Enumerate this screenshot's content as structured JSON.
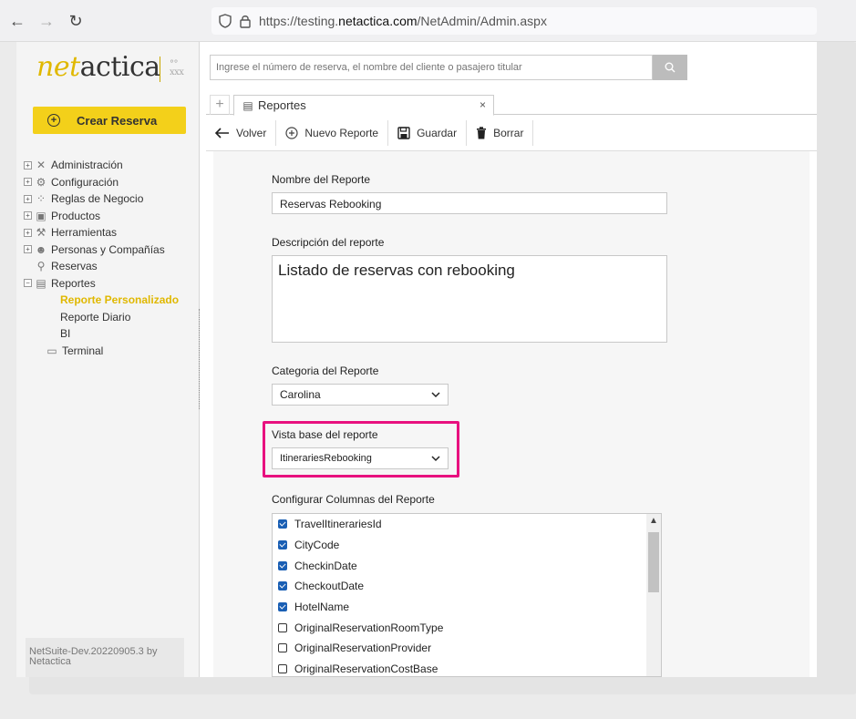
{
  "browser": {
    "url_prefix": "https://testing.",
    "url_domain": "netactica.com",
    "url_path": "/NetAdmin/Admin.aspx"
  },
  "logo": {
    "part1": "net",
    "part2": "actica"
  },
  "sidebar": {
    "crear_label": "Crear Reserva",
    "items": [
      {
        "label": "Administración"
      },
      {
        "label": "Configuración"
      },
      {
        "label": "Reglas de Negocio"
      },
      {
        "label": "Productos"
      },
      {
        "label": "Herramientas"
      },
      {
        "label": "Personas y Compañías"
      },
      {
        "label": "Reservas"
      },
      {
        "label": "Reportes"
      },
      {
        "label": "Reporte Personalizado"
      },
      {
        "label": "Reporte Diario"
      },
      {
        "label": "BI"
      },
      {
        "label": "Terminal"
      }
    ],
    "version": "NetSuite-Dev.20220905.3 by Netactica"
  },
  "search": {
    "placeholder": "Ingrese el número de reserva, el nombre del cliente o pasajero titular"
  },
  "tabs": {
    "active": "Reportes",
    "close": "×",
    "add": "+"
  },
  "toolbar": {
    "volver": "Volver",
    "nuevo": "Nuevo Reporte",
    "guardar": "Guardar",
    "borrar": "Borrar"
  },
  "form": {
    "nombre_label": "Nombre del Reporte",
    "nombre_value": "Reservas Rebooking",
    "descripcion_label": "Descripción del reporte",
    "descripcion_value": "Listado de reservas con rebooking",
    "categoria_label": "Categoria del Reporte",
    "categoria_value": "Carolina",
    "vista_label": "Vista base del reporte",
    "vista_value": "ItinerariesRebooking",
    "columnas_label": "Configurar Columnas del Reporte",
    "columns": [
      {
        "name": "TravelItinerariesId",
        "checked": true
      },
      {
        "name": "CityCode",
        "checked": true
      },
      {
        "name": "CheckinDate",
        "checked": true
      },
      {
        "name": "CheckoutDate",
        "checked": true
      },
      {
        "name": "HotelName",
        "checked": true
      },
      {
        "name": "OriginalReservationRoomType",
        "checked": false
      },
      {
        "name": "OriginalReservationProvider",
        "checked": false
      },
      {
        "name": "OriginalReservationCostBase",
        "checked": false
      }
    ]
  },
  "colors": {
    "accent": "#f3d01a",
    "highlight": "#e8117f",
    "active_text": "#e0b800"
  }
}
